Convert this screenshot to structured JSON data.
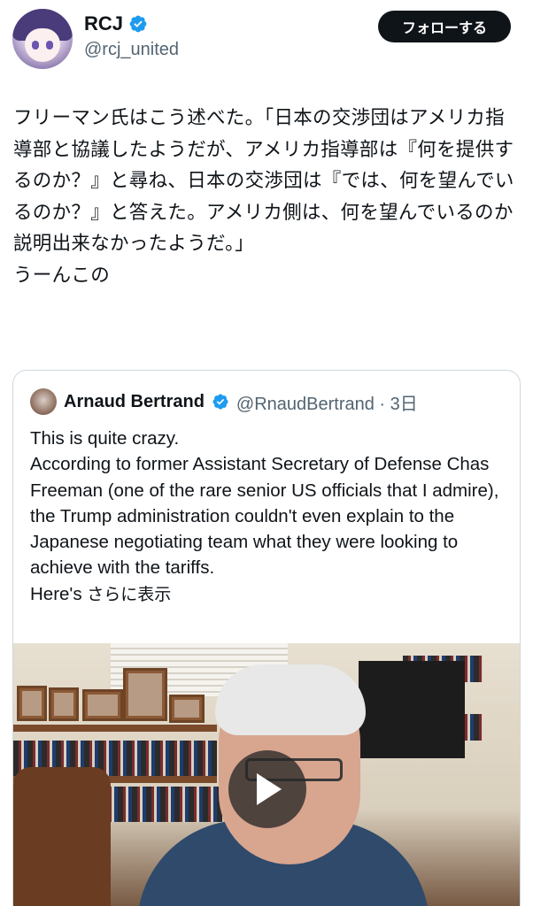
{
  "author": {
    "name": "RCJ",
    "handle": "@rcj_united",
    "verified_icon": "verified-badge-icon"
  },
  "follow_button": {
    "label": "フォローする"
  },
  "tweet": {
    "text": "フリーマン氏はこう述べた。「日本の交渉団はアメリカ指導部と協議したようだが、アメリカ指導部は『何を提供するのか？』と尋ね、日本の交渉団は『では、何を望んでいるのか？』と答えた。アメリカ側は、何を望んでいるのか説明出来なかったようだ。」\nうーんこの"
  },
  "quoted_tweet": {
    "author_name": "Arnaud Bertrand",
    "handle_and_time": "@RnaudBertrand · 3日",
    "text": "This is quite crazy.\nAccording to former Assistant Secretary of Defense Chas Freeman (one of the rare senior US officials that I admire), the Trump administration couldn't even explain to the Japanese negotiating team what they were looking to achieve with the tariffs.\nHere's ",
    "show_more": "さらに表示",
    "video_play_icon": "play-icon"
  },
  "colors": {
    "text_primary": "#0f1419",
    "text_secondary": "#536471",
    "verified": "#1d9bf0",
    "border": "#cfd9de",
    "button_bg": "#0f1419"
  }
}
